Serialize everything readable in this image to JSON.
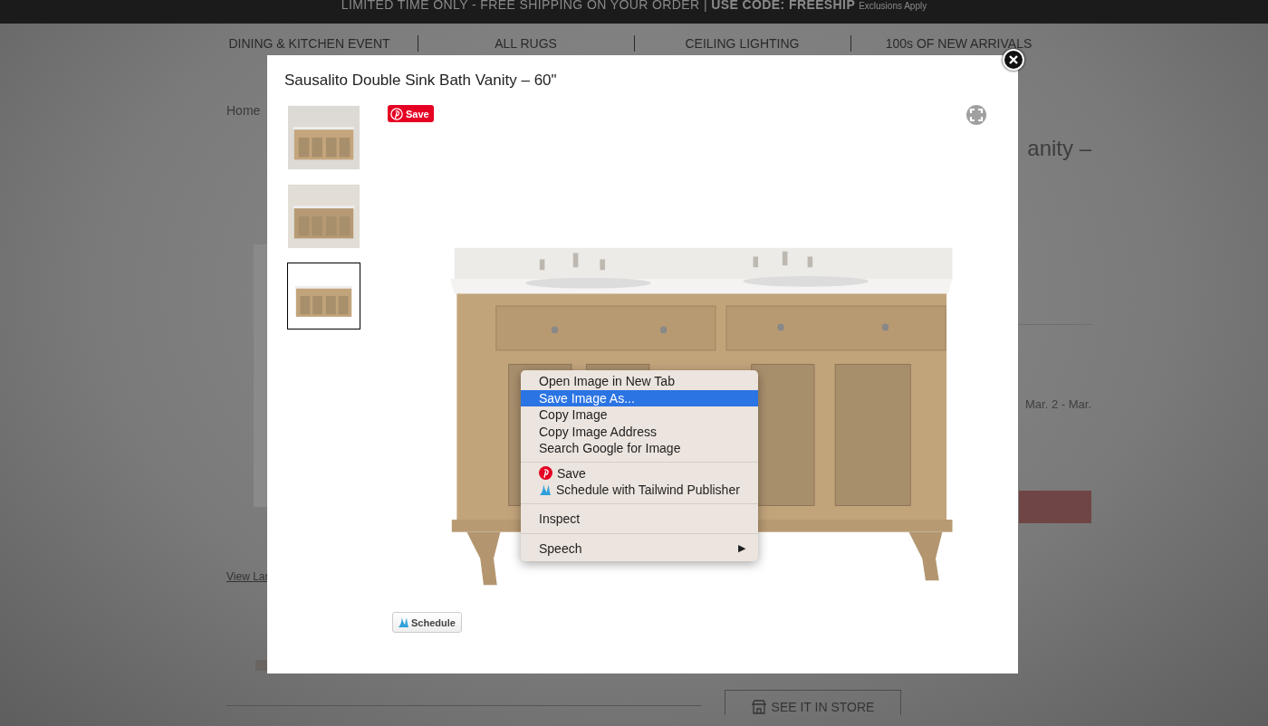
{
  "banner": {
    "text": "LIMITED TIME ONLY - FREE SHIPPING ON YOUR ORDER | **USE CODE: FREESHIP**",
    "note": "Exclusions Apply"
  },
  "nav": [
    "DINING & KITCHEN EVENT",
    "ALL RUGS",
    "CEILING LIGHTING",
    "100s OF NEW ARRIVALS"
  ],
  "page": {
    "breadcrumb": "Home",
    "title_fragment": "anity –",
    "view_link": "View Lar",
    "delivery_fragment": "Mar. 2 - Mar.",
    "store_button": "SEE IT IN STORE"
  },
  "lightbox": {
    "title": "Sausalito Double Sink Bath Vanity – 60\"",
    "pin_button": "Save",
    "schedule_button": "Schedule",
    "thumbnails": [
      {
        "selected": false
      },
      {
        "selected": false
      },
      {
        "selected": true
      }
    ]
  },
  "context_menu": {
    "groups": [
      [
        {
          "kind": "plain",
          "label": "Open Image in New Tab",
          "selected": false
        },
        {
          "kind": "plain",
          "label": "Save Image As...",
          "selected": true
        },
        {
          "kind": "plain",
          "label": "Copy Image",
          "selected": false
        },
        {
          "kind": "plain",
          "label": "Copy Image Address",
          "selected": false
        },
        {
          "kind": "plain",
          "label": "Search Google for Image",
          "selected": false
        }
      ],
      [
        {
          "kind": "pinterest",
          "label": "Save",
          "selected": false
        },
        {
          "kind": "tailwind",
          "label": "Schedule with Tailwind Publisher",
          "selected": false
        }
      ],
      [
        {
          "kind": "plain",
          "label": "Inspect",
          "selected": false
        }
      ],
      [
        {
          "kind": "submenu",
          "label": "Speech",
          "arrow": "▶",
          "selected": false
        }
      ]
    ]
  }
}
